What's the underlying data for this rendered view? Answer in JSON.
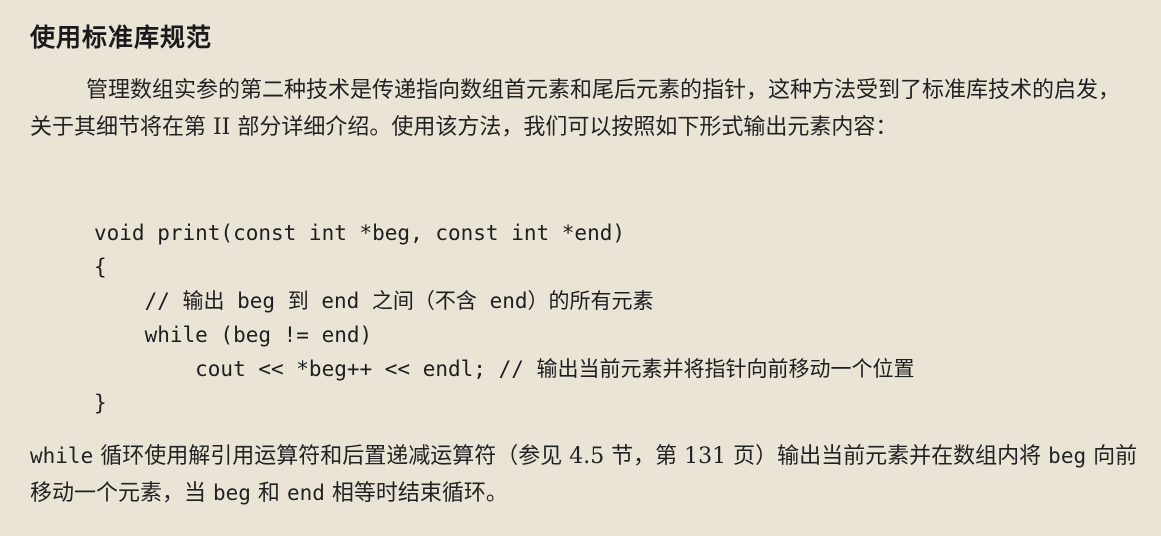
{
  "section": {
    "title": "使用标准库规范"
  },
  "paragraph1": {
    "text": "管理数组实参的第二种技术是传递指向数组首元素和尾后元素的指针，这种方法受到了标准库技术的启发，关于其细节将在第 II 部分详细介绍。使用该方法，我们可以按照如下形式输出元素内容："
  },
  "code": {
    "lines": [
      "void print(const int *beg, const int *end)",
      "{",
      "    // 输出 beg 到 end 之间（不含 end）的所有元素",
      "    while (beg != end)",
      "        cout << *beg++ << endl; // 输出当前元素并将指针向前移动一个位置",
      "}"
    ]
  },
  "paragraph2": {
    "kw_while": "while",
    "text_a": " 循环使用解引用运算符和后置递减运算符（参见 4.5 节，第 131 页）输出当前元素并在数组内将 ",
    "kw_beg1": "beg",
    "text_b": " 向前移动一个元素，当 ",
    "kw_beg2": "beg",
    "text_c": " 和 ",
    "kw_end": "end",
    "text_d": " 相等时结束循环。"
  }
}
